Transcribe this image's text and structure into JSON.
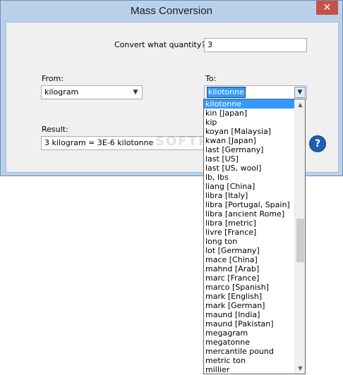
{
  "window": {
    "title": "Mass Conversion",
    "close_glyph": "✕"
  },
  "form": {
    "quantity_label": "Convert what quantity?",
    "quantity_value": "3",
    "from_label": "From:",
    "from_value": "kilogram",
    "to_label": "To:",
    "to_value": "kilotonne",
    "result_label": "Result:",
    "result_value": "3 kilogram = 3E-6 kilotonne",
    "help_glyph": "?"
  },
  "watermark": "SOFTPEDIA",
  "dropdown": {
    "selected_index": 0,
    "items": [
      "kilotonne",
      "kin [Japan]",
      "kip",
      "koyan [Malaysia]",
      "kwan [Japan]",
      "last [Germany]",
      "last [US]",
      "last [US, wool]",
      "lb, lbs",
      "liang [China]",
      "libra [Italy]",
      "libra [Portugal, Spain]",
      "libra [ancient Rome]",
      "libra [metric]",
      "livre [France]",
      "long ton",
      "lot [Germany]",
      "mace [China]",
      "mahnd [Arab]",
      "marc [France]",
      "marco [Spanish]",
      "mark [English]",
      "mark [German]",
      "maund [India]",
      "maund [Pakistan]",
      "megagram",
      "megatonne",
      "mercantile pound",
      "metric ton",
      "millier"
    ],
    "scroll_position": 0.52
  },
  "icons": {
    "dropdown_arrow": "chevron-down-icon",
    "scroll_up": "chevron-up-icon",
    "scroll_down": "chevron-down-icon",
    "help": "help-icon"
  },
  "colors": {
    "title_bar": "#b9d1ea",
    "close_button": "#c7504a",
    "selection": "#3399ff",
    "help_icon": "#1f5fb0"
  }
}
